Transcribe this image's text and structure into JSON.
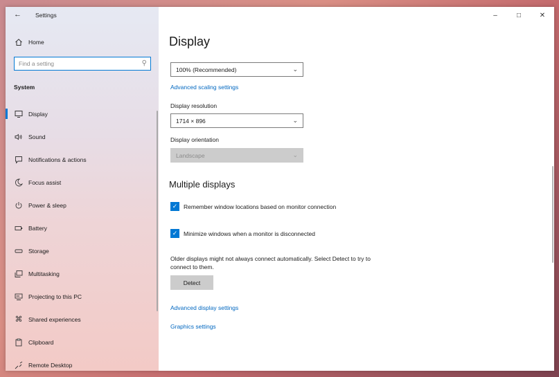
{
  "window": {
    "app_title": "Settings",
    "controls": {
      "minimize": "–",
      "maximize": "□",
      "close": "✕"
    }
  },
  "sidebar": {
    "home_label": "Home",
    "search_placeholder": "Find a setting",
    "section_header": "System",
    "items": [
      {
        "label": "Display",
        "icon": "monitor-icon",
        "selected": true
      },
      {
        "label": "Sound",
        "icon": "speaker-icon"
      },
      {
        "label": "Notifications & actions",
        "icon": "notification-icon"
      },
      {
        "label": "Focus assist",
        "icon": "moon-icon"
      },
      {
        "label": "Power & sleep",
        "icon": "power-icon"
      },
      {
        "label": "Battery",
        "icon": "battery-icon"
      },
      {
        "label": "Storage",
        "icon": "storage-icon"
      },
      {
        "label": "Multitasking",
        "icon": "multitasking-icon"
      },
      {
        "label": "Projecting to this PC",
        "icon": "projector-icon"
      },
      {
        "label": "Shared experiences",
        "icon": "shared-icon"
      },
      {
        "label": "Clipboard",
        "icon": "clipboard-icon"
      },
      {
        "label": "Remote Desktop",
        "icon": "remote-desktop-icon"
      }
    ]
  },
  "main": {
    "page_title": "Display",
    "scale_dropdown_value": "100% (Recommended)",
    "advanced_scaling_link": "Advanced scaling settings",
    "resolution_label": "Display resolution",
    "resolution_value": "1714 × 896",
    "orientation_label": "Display orientation",
    "orientation_value": "Landscape",
    "multiple_displays_heading": "Multiple displays",
    "checkbox_remember": {
      "label": "Remember window locations based on monitor connection",
      "checked": true
    },
    "checkbox_minimize": {
      "label": "Minimize windows when a monitor is disconnected",
      "checked": true
    },
    "detect_description": "Older displays might not always connect automatically. Select Detect to try to connect to them.",
    "detect_button": "Detect",
    "advanced_display_link": "Advanced display settings",
    "graphics_link": "Graphics settings"
  },
  "colors": {
    "accent": "#0078d4",
    "link": "#0067c0",
    "disabled": "#cccccc"
  }
}
